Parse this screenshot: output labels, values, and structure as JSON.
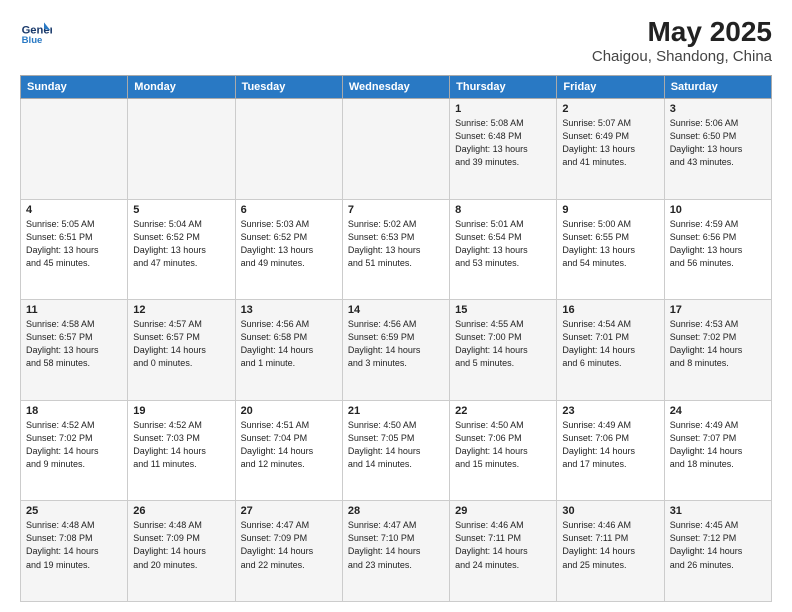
{
  "header": {
    "logo_line1": "General",
    "logo_line2": "Blue",
    "title": "May 2025",
    "subtitle": "Chaigou, Shandong, China"
  },
  "weekdays": [
    "Sunday",
    "Monday",
    "Tuesday",
    "Wednesday",
    "Thursday",
    "Friday",
    "Saturday"
  ],
  "weeks": [
    [
      {
        "num": "",
        "info": ""
      },
      {
        "num": "",
        "info": ""
      },
      {
        "num": "",
        "info": ""
      },
      {
        "num": "",
        "info": ""
      },
      {
        "num": "1",
        "info": "Sunrise: 5:08 AM\nSunset: 6:48 PM\nDaylight: 13 hours\nand 39 minutes."
      },
      {
        "num": "2",
        "info": "Sunrise: 5:07 AM\nSunset: 6:49 PM\nDaylight: 13 hours\nand 41 minutes."
      },
      {
        "num": "3",
        "info": "Sunrise: 5:06 AM\nSunset: 6:50 PM\nDaylight: 13 hours\nand 43 minutes."
      }
    ],
    [
      {
        "num": "4",
        "info": "Sunrise: 5:05 AM\nSunset: 6:51 PM\nDaylight: 13 hours\nand 45 minutes."
      },
      {
        "num": "5",
        "info": "Sunrise: 5:04 AM\nSunset: 6:52 PM\nDaylight: 13 hours\nand 47 minutes."
      },
      {
        "num": "6",
        "info": "Sunrise: 5:03 AM\nSunset: 6:52 PM\nDaylight: 13 hours\nand 49 minutes."
      },
      {
        "num": "7",
        "info": "Sunrise: 5:02 AM\nSunset: 6:53 PM\nDaylight: 13 hours\nand 51 minutes."
      },
      {
        "num": "8",
        "info": "Sunrise: 5:01 AM\nSunset: 6:54 PM\nDaylight: 13 hours\nand 53 minutes."
      },
      {
        "num": "9",
        "info": "Sunrise: 5:00 AM\nSunset: 6:55 PM\nDaylight: 13 hours\nand 54 minutes."
      },
      {
        "num": "10",
        "info": "Sunrise: 4:59 AM\nSunset: 6:56 PM\nDaylight: 13 hours\nand 56 minutes."
      }
    ],
    [
      {
        "num": "11",
        "info": "Sunrise: 4:58 AM\nSunset: 6:57 PM\nDaylight: 13 hours\nand 58 minutes."
      },
      {
        "num": "12",
        "info": "Sunrise: 4:57 AM\nSunset: 6:57 PM\nDaylight: 14 hours\nand 0 minutes."
      },
      {
        "num": "13",
        "info": "Sunrise: 4:56 AM\nSunset: 6:58 PM\nDaylight: 14 hours\nand 1 minute."
      },
      {
        "num": "14",
        "info": "Sunrise: 4:56 AM\nSunset: 6:59 PM\nDaylight: 14 hours\nand 3 minutes."
      },
      {
        "num": "15",
        "info": "Sunrise: 4:55 AM\nSunset: 7:00 PM\nDaylight: 14 hours\nand 5 minutes."
      },
      {
        "num": "16",
        "info": "Sunrise: 4:54 AM\nSunset: 7:01 PM\nDaylight: 14 hours\nand 6 minutes."
      },
      {
        "num": "17",
        "info": "Sunrise: 4:53 AM\nSunset: 7:02 PM\nDaylight: 14 hours\nand 8 minutes."
      }
    ],
    [
      {
        "num": "18",
        "info": "Sunrise: 4:52 AM\nSunset: 7:02 PM\nDaylight: 14 hours\nand 9 minutes."
      },
      {
        "num": "19",
        "info": "Sunrise: 4:52 AM\nSunset: 7:03 PM\nDaylight: 14 hours\nand 11 minutes."
      },
      {
        "num": "20",
        "info": "Sunrise: 4:51 AM\nSunset: 7:04 PM\nDaylight: 14 hours\nand 12 minutes."
      },
      {
        "num": "21",
        "info": "Sunrise: 4:50 AM\nSunset: 7:05 PM\nDaylight: 14 hours\nand 14 minutes."
      },
      {
        "num": "22",
        "info": "Sunrise: 4:50 AM\nSunset: 7:06 PM\nDaylight: 14 hours\nand 15 minutes."
      },
      {
        "num": "23",
        "info": "Sunrise: 4:49 AM\nSunset: 7:06 PM\nDaylight: 14 hours\nand 17 minutes."
      },
      {
        "num": "24",
        "info": "Sunrise: 4:49 AM\nSunset: 7:07 PM\nDaylight: 14 hours\nand 18 minutes."
      }
    ],
    [
      {
        "num": "25",
        "info": "Sunrise: 4:48 AM\nSunset: 7:08 PM\nDaylight: 14 hours\nand 19 minutes."
      },
      {
        "num": "26",
        "info": "Sunrise: 4:48 AM\nSunset: 7:09 PM\nDaylight: 14 hours\nand 20 minutes."
      },
      {
        "num": "27",
        "info": "Sunrise: 4:47 AM\nSunset: 7:09 PM\nDaylight: 14 hours\nand 22 minutes."
      },
      {
        "num": "28",
        "info": "Sunrise: 4:47 AM\nSunset: 7:10 PM\nDaylight: 14 hours\nand 23 minutes."
      },
      {
        "num": "29",
        "info": "Sunrise: 4:46 AM\nSunset: 7:11 PM\nDaylight: 14 hours\nand 24 minutes."
      },
      {
        "num": "30",
        "info": "Sunrise: 4:46 AM\nSunset: 7:11 PM\nDaylight: 14 hours\nand 25 minutes."
      },
      {
        "num": "31",
        "info": "Sunrise: 4:45 AM\nSunset: 7:12 PM\nDaylight: 14 hours\nand 26 minutes."
      }
    ]
  ]
}
